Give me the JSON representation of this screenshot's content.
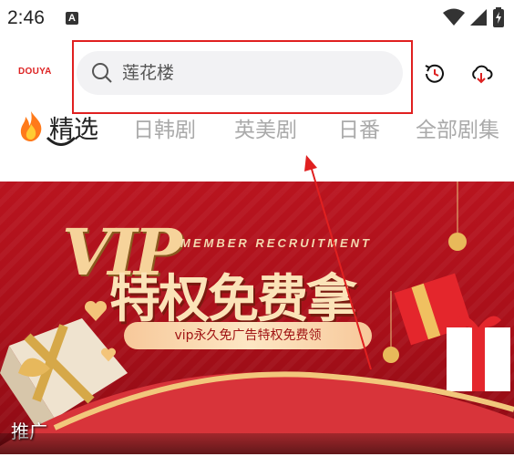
{
  "status_bar": {
    "time": "2:46",
    "badge": "A"
  },
  "header": {
    "logo_text": "DOUYA"
  },
  "search": {
    "placeholder": "莲花楼"
  },
  "tabs": [
    {
      "label": "精选",
      "active": true
    },
    {
      "label": "日韩剧",
      "active": false
    },
    {
      "label": "英美剧",
      "active": false
    },
    {
      "label": "日番",
      "active": false
    },
    {
      "label": "全部剧集",
      "active": false
    }
  ],
  "banner": {
    "vip": "VIP",
    "member": "MEMBER RECRUITMENT",
    "title": "特权免费拿",
    "subtitle": "vip永久免广告特权免费领",
    "tag": "推广"
  },
  "colors": {
    "accent": "#e02020",
    "banner_red": "#b9141f",
    "gold": "#f6d39a"
  }
}
